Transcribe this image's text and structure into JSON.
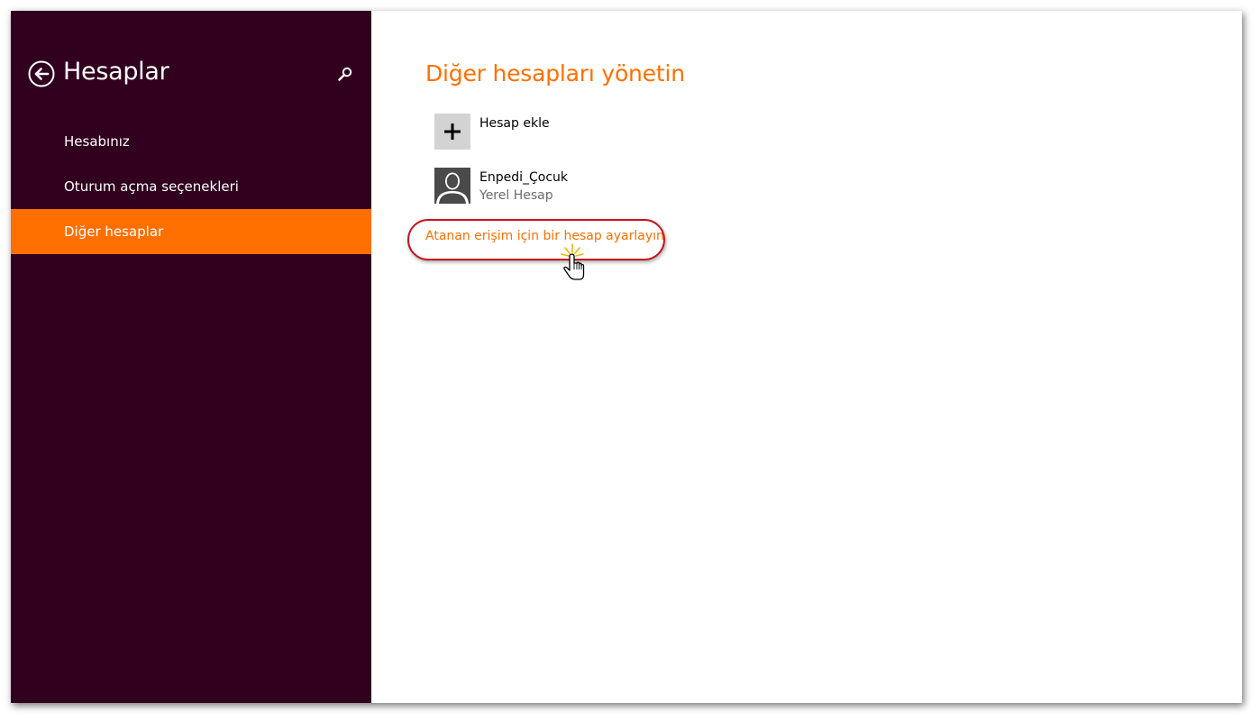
{
  "sidebar": {
    "title": "Hesaplar",
    "back_icon": "back-arrow-circle-icon",
    "search_icon": "search-icon",
    "items": [
      {
        "label": "Hesabınız",
        "active": false
      },
      {
        "label": "Oturum açma seçenekleri",
        "active": false
      },
      {
        "label": "Diğer hesaplar",
        "active": true
      }
    ]
  },
  "main": {
    "title": "Diğer hesapları yönetin",
    "add_account": {
      "label": "Hesap ekle",
      "icon": "plus-icon"
    },
    "accounts": [
      {
        "name": "Enpedi_Çocuk",
        "type": "Yerel Hesap",
        "icon": "user-silhouette-icon"
      }
    ],
    "assigned_access_link": "Atanan erişim için bir hesap ayarlayın"
  },
  "colors": {
    "sidebar_bg": "#30001e",
    "accent": "#ff6f00",
    "highlight": "#c6151c"
  }
}
